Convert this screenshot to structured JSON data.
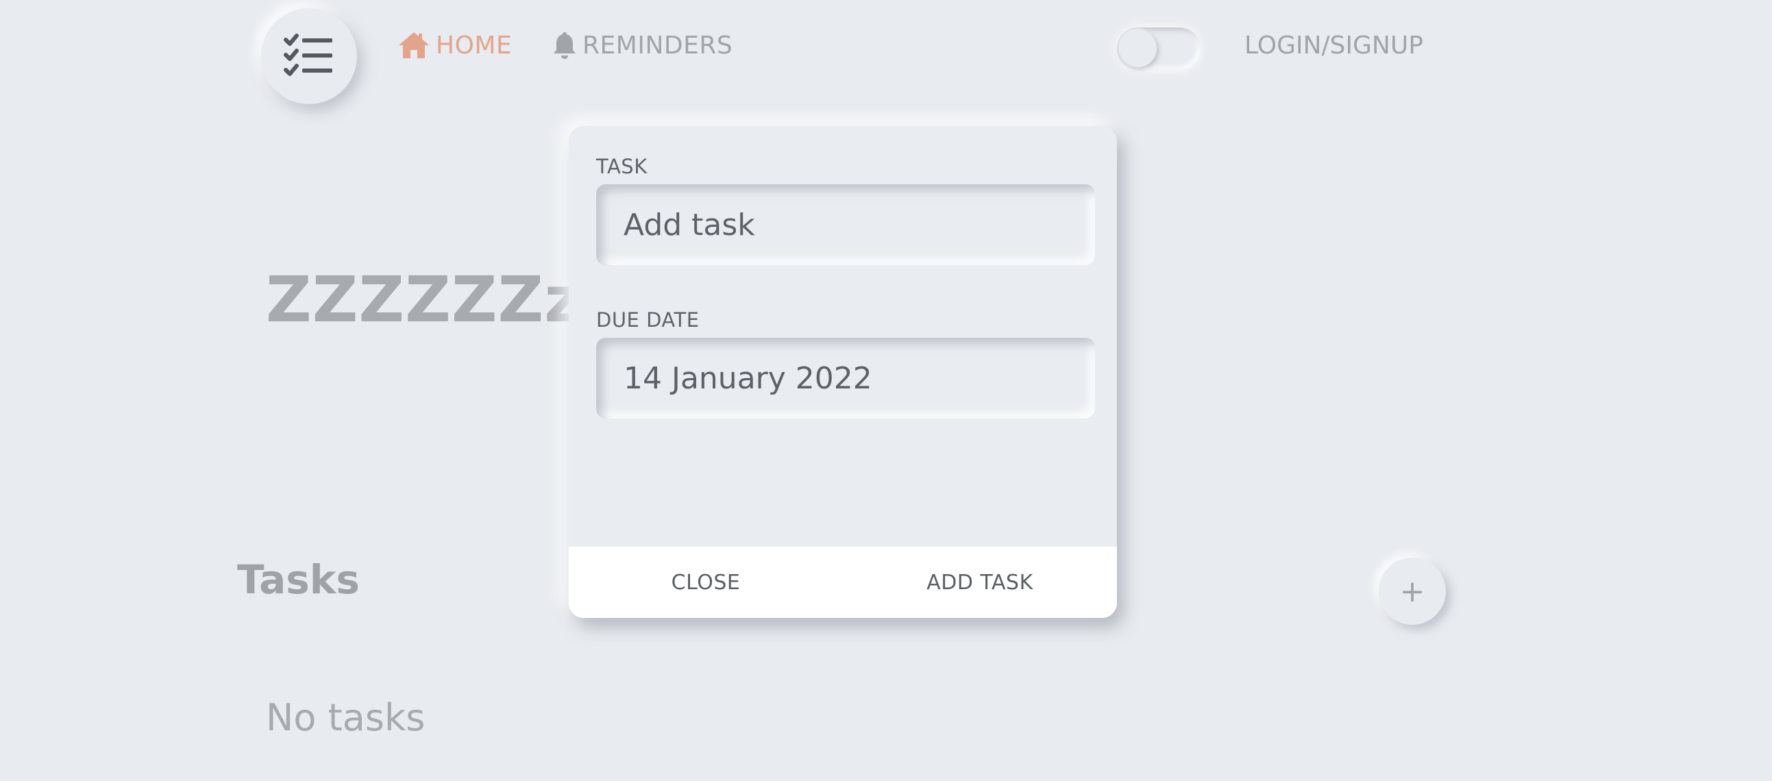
{
  "header": {
    "nav": {
      "home_label": "HOME",
      "reminders_label": "REMINDERS"
    },
    "login_label": "LOGIN/SIGNUP",
    "home_color": "#e2a58c",
    "logo_icon": "task-list-icon",
    "theme_toggle": {
      "state": "off"
    }
  },
  "main": {
    "greeting": "ZZZZZZzzzz",
    "tasks_title": "Tasks",
    "add_button_label": "+",
    "empty_text": "No tasks"
  },
  "modal": {
    "task_label": "TASK",
    "task_placeholder": "Add task",
    "due_date_label": "DUE DATE",
    "due_date_value": "14 January 2022",
    "close_label": "CLOSE",
    "add_label": "ADD TASK"
  }
}
